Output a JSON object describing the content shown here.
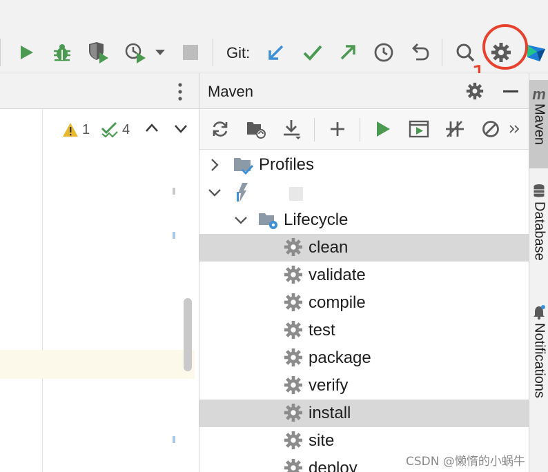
{
  "toolbar": {
    "git_label": "Git:",
    "annotation_number": "1",
    "icons": [
      "run-icon",
      "debug-icon",
      "coverage-icon",
      "profile-icon",
      "dropdown-icon",
      "stop-icon",
      "git-update-icon",
      "git-commit-icon",
      "git-push-icon",
      "history-icon",
      "rollback-icon",
      "search-icon",
      "settings-icon",
      "jetbrains-logo-icon"
    ]
  },
  "editor": {
    "warnings_count": "1",
    "checks_count": "4"
  },
  "maven": {
    "title": "Maven",
    "tree": {
      "profiles": "Profiles",
      "lifecycle": "Lifecycle",
      "phases": [
        "clean",
        "validate",
        "compile",
        "test",
        "package",
        "verify",
        "install",
        "site",
        "deploy"
      ],
      "selected": [
        "clean",
        "install"
      ]
    }
  },
  "right_strip": {
    "tabs": [
      "Maven",
      "Database",
      "Notifications"
    ]
  },
  "watermark": "CSDN @懒惰的小蜗牛",
  "colors": {
    "run_green": "#4c9a52",
    "git_blue": "#3d8fd6",
    "annotation_red": "#e8412e",
    "selection_gray": "#d8d8d8"
  }
}
